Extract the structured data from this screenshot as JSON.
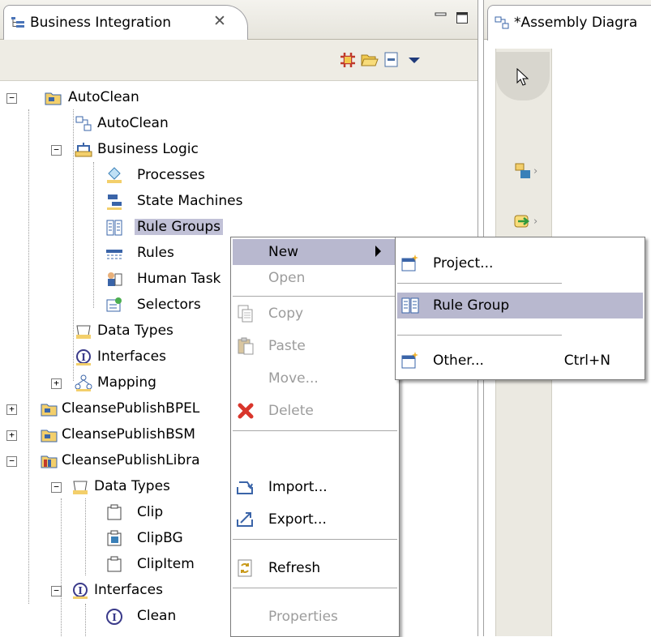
{
  "left_view": {
    "tab_title": "Business Integration",
    "tab_close": "✕"
  },
  "right_view": {
    "tab_title": "*Assembly Diagra"
  },
  "tree": [
    {
      "id": "autoclean-project",
      "label": "AutoClean",
      "expander": "−",
      "icon": "folder-icon"
    },
    {
      "id": "autoclean-assembly",
      "label": "AutoClean",
      "icon": "assembly-icon"
    },
    {
      "id": "business-logic",
      "label": "Business Logic",
      "expander": "−",
      "icon": "business-logic-icon"
    },
    {
      "id": "processes",
      "label": "Processes",
      "icon": "process-icon"
    },
    {
      "id": "state-machines",
      "label": "State Machines",
      "icon": "state-machine-icon"
    },
    {
      "id": "rule-groups",
      "label": "Rule Groups",
      "icon": "rule-group-icon",
      "selected": true
    },
    {
      "id": "rules",
      "label": "Rules",
      "icon": "rules-icon"
    },
    {
      "id": "human-task",
      "label": "Human Task",
      "icon": "human-task-icon"
    },
    {
      "id": "selectors",
      "label": "Selectors",
      "icon": "selector-icon"
    },
    {
      "id": "data-types",
      "label": "Data Types",
      "icon": "data-types-icon"
    },
    {
      "id": "interfaces",
      "label": "Interfaces",
      "icon": "interface-icon"
    },
    {
      "id": "mapping",
      "label": "Mapping",
      "expander": "+",
      "icon": "mapping-icon"
    },
    {
      "id": "cleanse-bpel",
      "label": "CleansePublishBPEL",
      "expander": "+",
      "icon": "folder-icon"
    },
    {
      "id": "cleanse-bsm",
      "label": "CleansePublishBSM",
      "expander": "+",
      "icon": "folder-icon"
    },
    {
      "id": "cleanse-library",
      "label": "CleansePublishLibra",
      "expander": "−",
      "icon": "library-icon"
    },
    {
      "id": "lib-data-types",
      "label": "Data Types",
      "expander": "−",
      "icon": "data-types-icon"
    },
    {
      "id": "clip",
      "label": "Clip",
      "icon": "business-object-icon"
    },
    {
      "id": "clipbg",
      "label": "ClipBG",
      "icon": "business-graph-icon"
    },
    {
      "id": "clipitem",
      "label": "ClipItem",
      "icon": "business-object-icon"
    },
    {
      "id": "lib-interfaces",
      "label": "Interfaces",
      "expander": "−",
      "icon": "interface-icon"
    },
    {
      "id": "clean",
      "label": "Clean",
      "icon": "interface-icon"
    }
  ],
  "context_menu": {
    "items": [
      {
        "label": "New",
        "enabled": true,
        "highlighted": true,
        "submenu": true
      },
      {
        "label": "Open",
        "enabled": false
      },
      {
        "label": "Copy",
        "enabled": false,
        "icon": "copy-icon"
      },
      {
        "label": "Paste",
        "enabled": false,
        "icon": "paste-icon"
      },
      {
        "label": "Move...",
        "enabled": false
      },
      {
        "label": "Delete",
        "enabled": false,
        "icon": "delete-icon"
      },
      {
        "label": "Import...",
        "enabled": true,
        "icon": "import-icon"
      },
      {
        "label": "Export...",
        "enabled": true,
        "icon": "export-icon"
      },
      {
        "label": "Refresh",
        "enabled": true,
        "icon": "refresh-icon"
      },
      {
        "label": "Properties",
        "enabled": false
      }
    ]
  },
  "submenu": {
    "items": [
      {
        "label": "Project...",
        "icon": "new-project-icon"
      },
      {
        "label": "Rule Group",
        "icon": "rule-group-icon",
        "highlighted": true
      },
      {
        "label": "Other...",
        "icon": "new-wizard-icon",
        "shortcut": "Ctrl+N"
      }
    ]
  },
  "colors": {
    "selection": "#c1c1d7",
    "menu_highlight": "#b8b8cf",
    "disabled_text": "#9c9c9c"
  }
}
